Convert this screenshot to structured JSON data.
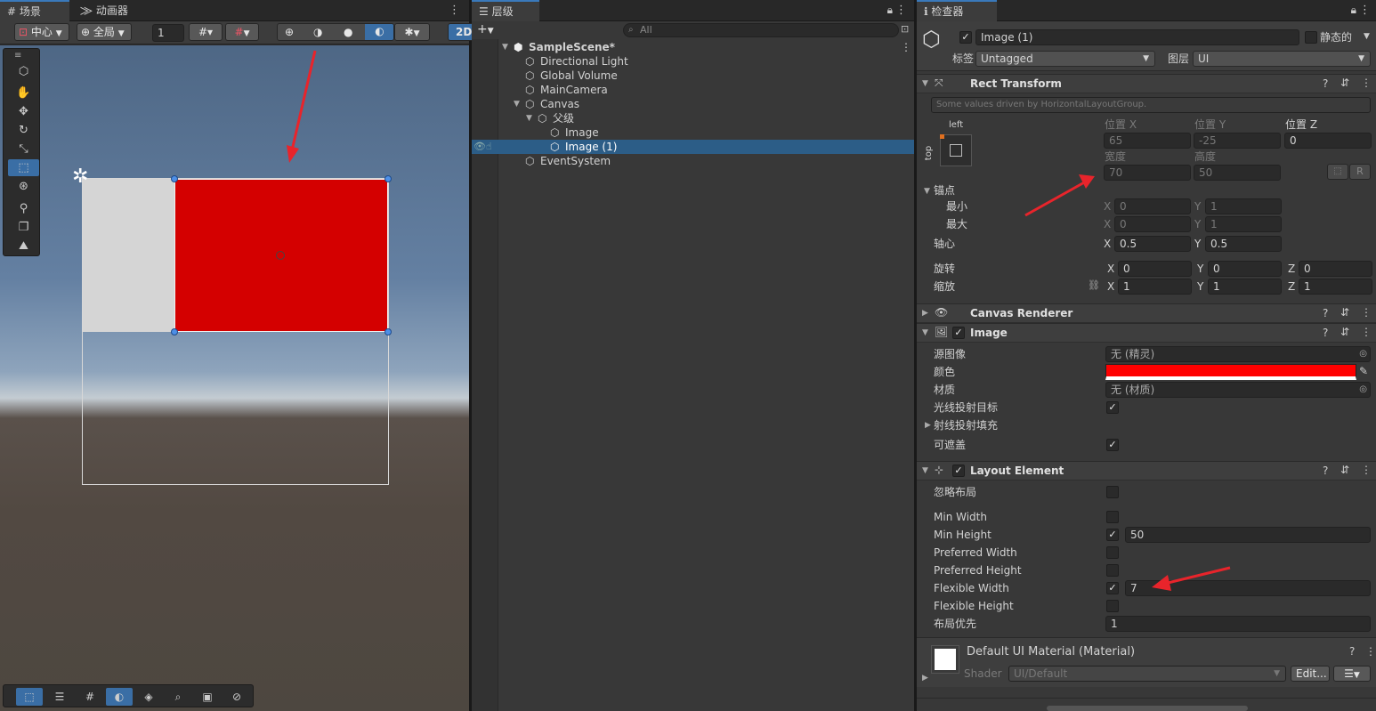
{
  "scene_panel": {
    "tabs": [
      "场景",
      "动画器"
    ],
    "pivot_label": "中心",
    "space_label": "全局",
    "scale_value": "1",
    "mode_2d": "2D",
    "tools": [
      "view-tool-icon",
      "hand-icon",
      "move-icon",
      "rotate-icon",
      "scale-icon",
      "rect-tool-icon",
      "transform-icon",
      "custom-tool-icon",
      "editor-tool-icon",
      "effects-icon"
    ]
  },
  "hierarchy": {
    "tab": "层级",
    "search_placeholder": "All",
    "scene_name": "SampleScene*",
    "items": [
      "Directional Light",
      "Global Volume",
      "MainCamera",
      "Canvas",
      "父级",
      "Image",
      "Image (1)",
      "EventSystem"
    ]
  },
  "inspector": {
    "tab": "检查器",
    "object_name": "Image (1)",
    "static_label": "静态的",
    "tag_label": "标签",
    "tag_value": "Untagged",
    "layer_label": "图层",
    "layer_value": "UI",
    "rect_transform": {
      "title": "Rect Transform",
      "driven_note": "Some values driven by HorizontalLayoutGroup.",
      "anchor_h": "left",
      "anchor_v": "top",
      "pos_x_label": "位置 X",
      "pos_x": "65",
      "pos_y_label": "位置 Y",
      "pos_y": "-25",
      "pos_z_label": "位置 Z",
      "pos_z": "0",
      "width_label": "宽度",
      "width": "70",
      "height_label": "高度",
      "height": "50",
      "r_button": "R",
      "anchors_label": "锚点",
      "min_label": "最小",
      "min_x": "0",
      "min_y": "1",
      "max_label": "最大",
      "max_x": "0",
      "max_y": "1",
      "pivot_label": "轴心",
      "pivot_x": "0.5",
      "pivot_y": "0.5",
      "rotation_label": "旋转",
      "rot_x": "0",
      "rot_y": "0",
      "rot_z": "0",
      "scale_label": "缩放",
      "scale_x": "1",
      "scale_y": "1",
      "scale_z": "1",
      "x": "X",
      "y": "Y",
      "z": "Z"
    },
    "canvas_renderer": {
      "title": "Canvas Renderer"
    },
    "image": {
      "title": "Image",
      "source_label": "源图像",
      "source_value": "无 (精灵)",
      "color_label": "颜色",
      "color_value": "#ff0000",
      "material_label": "材质",
      "material_value": "无 (材质)",
      "raycast_target_label": "光线投射目标",
      "raycast_padding_label": "射线投射填充",
      "maskable_label": "可遮盖"
    },
    "layout_element": {
      "title": "Layout Element",
      "ignore_layout_label": "忽略布局",
      "min_width_label": "Min Width",
      "min_height_label": "Min Height",
      "min_height_value": "50",
      "preferred_width_label": "Preferred Width",
      "preferred_height_label": "Preferred Height",
      "flexible_width_label": "Flexible Width",
      "flexible_width_value": "7",
      "flexible_height_label": "Flexible Height",
      "layout_priority_label": "布局优先",
      "layout_priority_value": "1"
    },
    "material": {
      "title": "Default UI Material (Material)",
      "shader_label": "Shader",
      "shader_value": "UI/Default",
      "edit_button": "Edit..."
    }
  }
}
